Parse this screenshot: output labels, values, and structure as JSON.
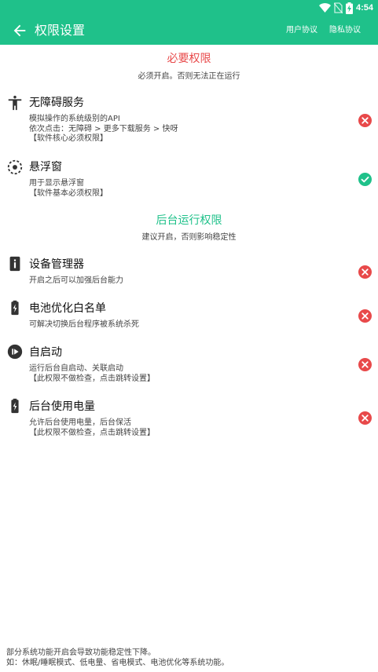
{
  "status_bar": {
    "time": "4:54",
    "icons": [
      "wifi-icon",
      "no-sim-icon",
      "battery-charging-icon"
    ]
  },
  "app_bar": {
    "title": "权限设置",
    "back_icon": "arrow-back-icon",
    "links": {
      "user_agreement": "用户协议",
      "privacy_policy": "隐私协议"
    }
  },
  "colors": {
    "accent": "#1fc18a",
    "required": "#e8494a",
    "granted": "#1fc18a",
    "denied": "#e8494a"
  },
  "sections": {
    "required": {
      "title": "必要权限",
      "subtitle": "必须开启。否则无法正在运行"
    },
    "background": {
      "title": "后台运行权限",
      "subtitle": "建议开启，否则影响稳定性"
    }
  },
  "permissions": {
    "accessibility": {
      "title": "无障碍服务",
      "desc": "模拟操作的系统级别的API\n依次点击：无障碍 > 更多下载服务 > 快呀\n【软件核心必须权限】",
      "icon": "accessibility-icon",
      "status": "denied"
    },
    "floating_window": {
      "title": "悬浮窗",
      "desc": "用于显示悬浮窗\n【软件基本必须权限】",
      "icon": "floating-window-icon",
      "status": "granted"
    },
    "device_admin": {
      "title": "设备管理器",
      "desc": "开启之后可以加强后台能力",
      "icon": "device-admin-icon",
      "status": "denied"
    },
    "battery_whitelist": {
      "title": "电池优化白名单",
      "desc": "可解决切换后台程序被系统杀死",
      "icon": "battery-icon",
      "status": "denied"
    },
    "auto_start": {
      "title": "自启动",
      "desc": "运行后台自启动、关联启动\n【此权限不做检查，点击跳转设置】",
      "icon": "auto-start-icon",
      "status": "denied"
    },
    "background_power": {
      "title": "后台使用电量",
      "desc": "允许后台使用电量，后台保活\n【此权限不做检查，点击跳转设置】",
      "icon": "battery-icon",
      "status": "denied"
    }
  },
  "footer": {
    "note": "部分系统功能开启会导致功能稳定性下降。\n如：休眠/睡眠模式、低电量、省电模式、电池优化等系统功能。"
  }
}
